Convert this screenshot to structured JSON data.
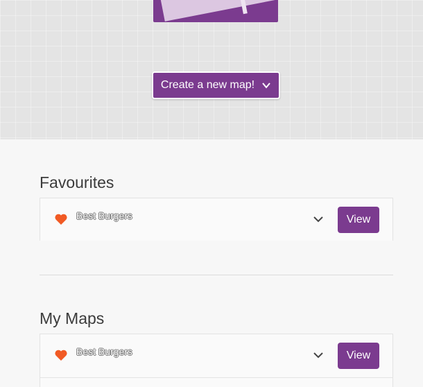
{
  "hero": {
    "create_button_label": "Create a new map!"
  },
  "favourites": {
    "title": "Favourites",
    "items": [
      {
        "name": "Best Burgers",
        "view_label": "View"
      }
    ]
  },
  "my_maps": {
    "title": "My Maps",
    "items": [
      {
        "name": "Best Burgers",
        "view_label": "View"
      }
    ]
  },
  "colors": {
    "accent": "#7b3b8f",
    "heart": "#f15a24",
    "background": "#f7f7f7"
  },
  "icons": [
    "map-illustration-icon",
    "chevron-down-icon",
    "heart-icon"
  ]
}
